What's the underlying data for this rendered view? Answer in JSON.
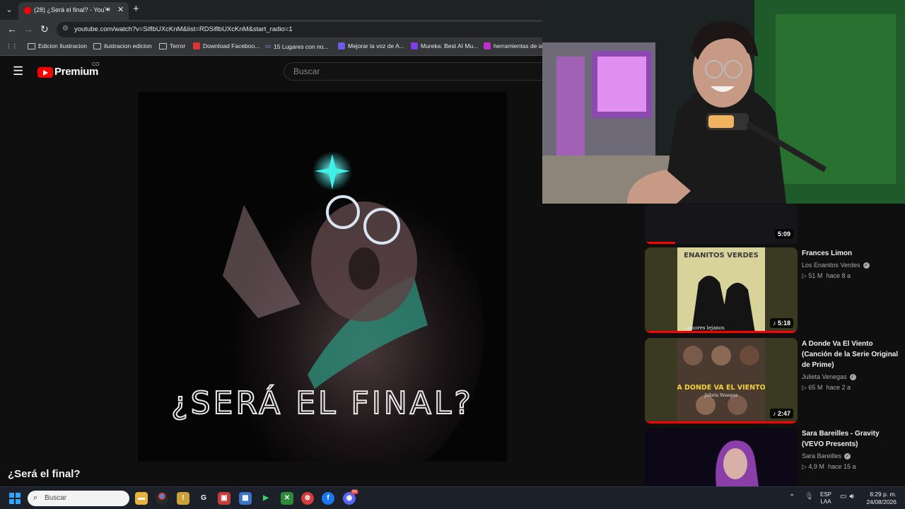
{
  "browser": {
    "tab": {
      "title": "(28) ¿Será el final? - YouTube",
      "audio_icon": "speaker-icon"
    },
    "url": "youtube.com/watch?v=SiflbUXcKnM&list=RDSiflbUXcKnM&start_radio=1",
    "bookmarks": [
      {
        "label": "Edicion Ilustracion",
        "icon": "folder-icon"
      },
      {
        "label": "ilustracion edicion",
        "icon": "folder-icon"
      },
      {
        "label": "Terror",
        "icon": "folder-icon"
      },
      {
        "label": "Download Faceboo...",
        "icon": "site-icon"
      },
      {
        "label": "15 Lugares con no...",
        "icon": "chat-icon"
      },
      {
        "label": "Mejorar la voz de A...",
        "icon": "site-icon"
      },
      {
        "label": "Mureka: Best AI Mu...",
        "icon": "site-icon"
      },
      {
        "label": "herramientas de ia",
        "icon": "site-icon"
      }
    ]
  },
  "youtube": {
    "brand": "Premium",
    "country": "CO",
    "search_placeholder": "Buscar",
    "video_title": "¿Será el final?",
    "artwork_text": "¿SERÁ EL FINAL?"
  },
  "related": [
    {
      "title": "",
      "channel": "",
      "stats": "",
      "duration": "5:09"
    },
    {
      "title": "Frances Limon",
      "channel": "Los Enanitos Verdes",
      "views": "51 M",
      "age": "hace 8 a",
      "duration": "5:18",
      "thumb_caption": "ENANITOS VERDES",
      "thumb_sub": "amores lejanos"
    },
    {
      "title": "A Donde Va El Viento (Canción de la Serie Original de Prime)",
      "channel": "Julieta Venegas",
      "views": "65 M",
      "age": "hace 2 a",
      "duration": "2:47",
      "thumb_caption": "A DONDE VA EL VIENTO",
      "thumb_sub": "Julieta Venegas"
    },
    {
      "title": "Sara Bareilles - Gravity (VEVO Presents)",
      "channel": "Sara Bareilles",
      "views": "4,9 M",
      "age": "hace 15 a",
      "duration": ""
    }
  ],
  "taskbar": {
    "search_placeholder": "Buscar",
    "language": "ESP",
    "language_sub": "LAA",
    "time": "8:29 p. m.",
    "date": "24/08/2026",
    "badge": "99"
  },
  "colors": {
    "yt_red": "#ff0000",
    "accent_cyan": "#3ff0e8"
  }
}
